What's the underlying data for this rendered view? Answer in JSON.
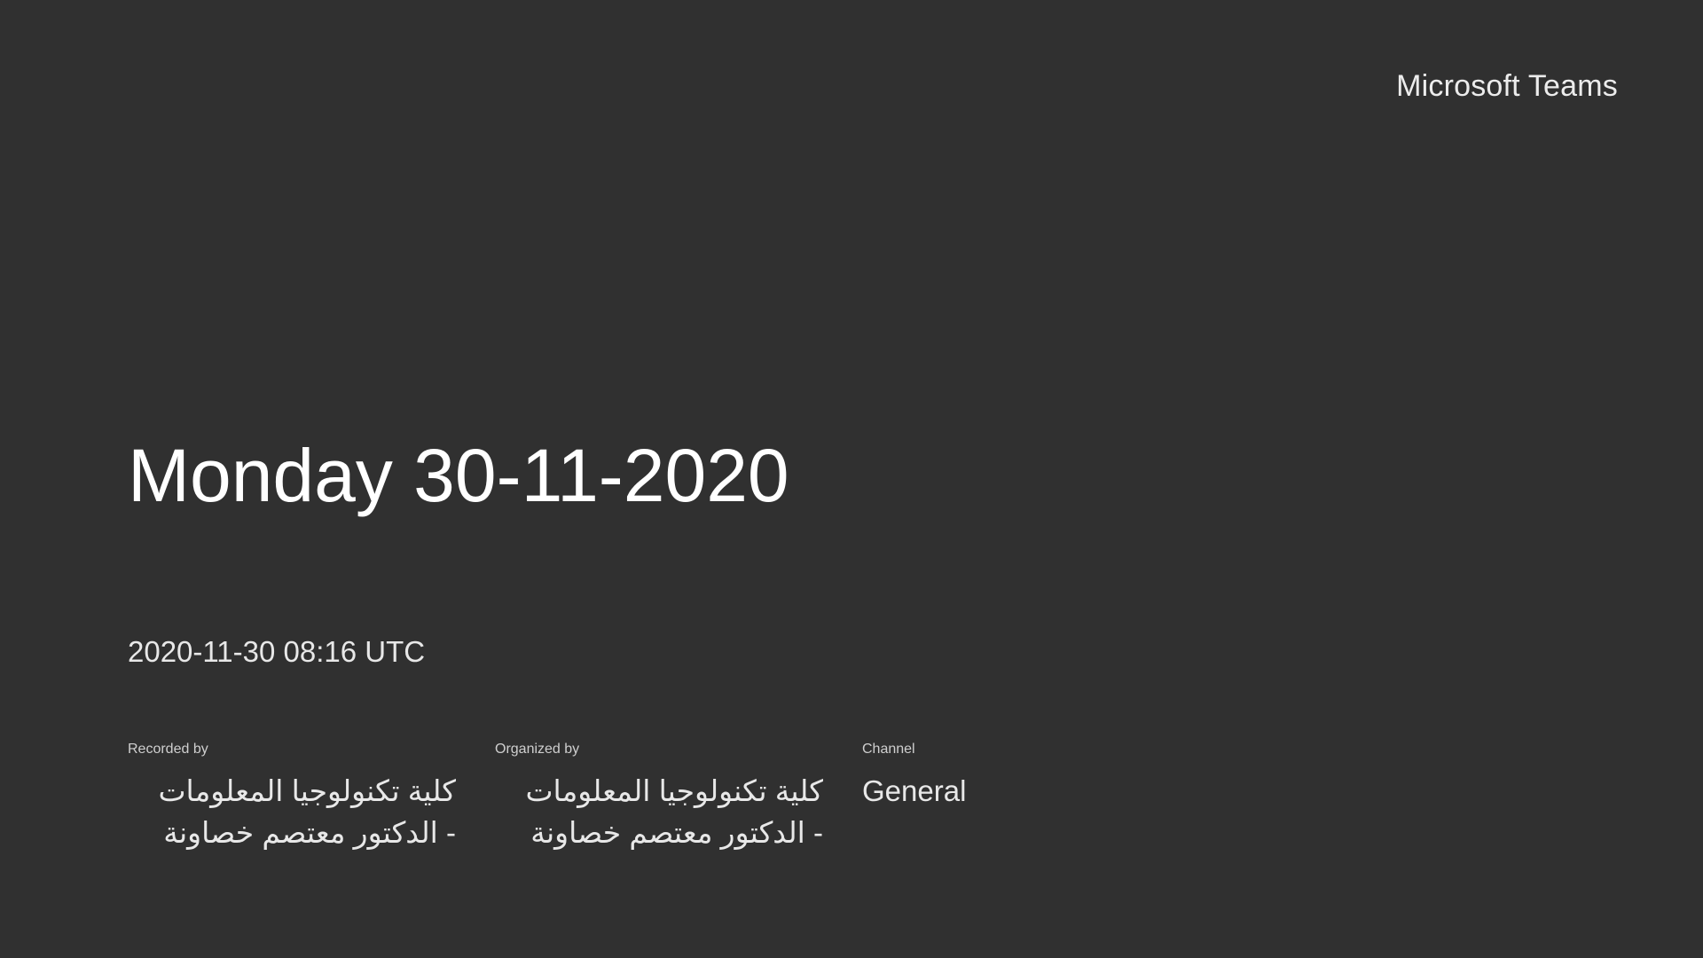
{
  "brand": {
    "name": "Microsoft Teams"
  },
  "meeting": {
    "title": "Monday 30-11-2020",
    "timestamp": "2020-11-30 08:16 UTC"
  },
  "meta": {
    "recorded_by": {
      "label": "Recorded by",
      "line1": "كلية تكنولوجيا المعلومات",
      "line2": "- الدكتور معتصم خصاونة"
    },
    "organized_by": {
      "label": "Organized by",
      "line1": "كلية تكنولوجيا المعلومات",
      "line2": "- الدكتور معتصم خصاونة"
    },
    "channel": {
      "label": "Channel",
      "value": "General"
    }
  },
  "colors": {
    "background": "#303030",
    "text": "#ffffff"
  }
}
